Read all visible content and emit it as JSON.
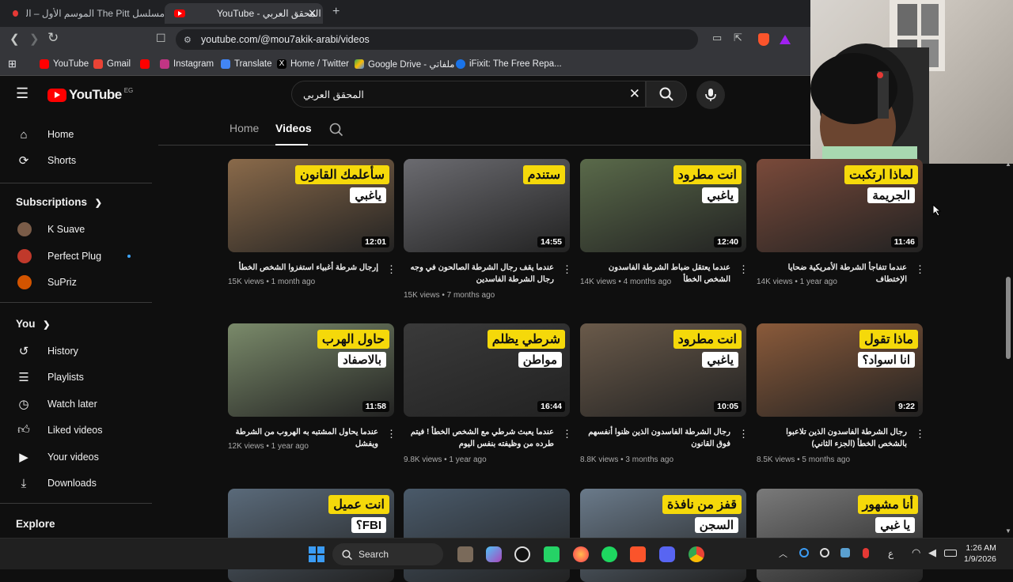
{
  "browser": {
    "tabs": [
      {
        "title": "مسلسل The Pitt الموسم الأول – الحلقة",
        "active": false
      },
      {
        "title": "YouTube - المحقق العربي",
        "active": true
      }
    ],
    "url": "youtube.com/@mou7akik-arabi/videos",
    "bookmarks": [
      {
        "label": "YouTube",
        "color": "#ff0000"
      },
      {
        "label": "Gmail",
        "color": "#ea4335"
      },
      {
        "label": "",
        "color": "#ff0000"
      },
      {
        "label": "Instagram",
        "color": "#c13584"
      },
      {
        "label": "Translate",
        "color": "#4285f4"
      },
      {
        "label": "Home / Twitter",
        "color": "#000000"
      },
      {
        "label": "Google Drive - ملفاتي",
        "color": "#34a853"
      },
      {
        "label": "iFixit: The Free Repa...",
        "color": "#1a73e8"
      }
    ]
  },
  "youtube": {
    "logo_text": "YouTube",
    "country_code": "EG",
    "search_value": "المحقق العربي",
    "sidebar": {
      "main": [
        {
          "label": "Home",
          "icon": "home-icon"
        },
        {
          "label": "Shorts",
          "icon": "shorts-icon"
        }
      ],
      "subscriptions_title": "Subscriptions",
      "subscriptions": [
        {
          "label": "K Suave",
          "color": "#7a5c48"
        },
        {
          "label": "Perfect Plug",
          "color": "#c0392b"
        },
        {
          "label": "SuPriz",
          "color": "#d35400"
        }
      ],
      "you_title": "You",
      "you": [
        {
          "label": "History",
          "icon": "history-icon"
        },
        {
          "label": "Playlists",
          "icon": "playlists-icon"
        },
        {
          "label": "Watch later",
          "icon": "clock-icon"
        },
        {
          "label": "Liked videos",
          "icon": "thumbs-up-icon"
        },
        {
          "label": "Your videos",
          "icon": "video-icon"
        },
        {
          "label": "Downloads",
          "icon": "download-icon"
        }
      ],
      "explore_title": "Explore"
    },
    "channel_tabs": [
      "Home",
      "Videos"
    ],
    "videos": [
      {
        "caption": "سأعلمك القانون",
        "caption2": "ياغبي",
        "duration": "12:01",
        "title": "إرجال شرطة أغبياء استفزوا الشخص الخطأ",
        "views": "15K views",
        "age": "1 month ago",
        "bg": "#8a6a4a"
      },
      {
        "caption": "ستندم",
        "caption2": "",
        "duration": "14:55",
        "title": "عندما يقف رجال الشرطة الصالحون في وجه رجال الشرطة الفاسدين",
        "views": "15K views",
        "age": "7 months ago",
        "bg": "#6b6b70"
      },
      {
        "caption": "انت مطرود",
        "caption2": "ياغبي",
        "duration": "12:40",
        "title": "عندما يعتقل ضباط الشرطة الفاسدون الشخص الخطأ",
        "views": "14K views",
        "age": "4 months ago",
        "bg": "#5a6a4a"
      },
      {
        "caption": "لماذا ارتكبت",
        "caption2": "الجريمة",
        "duration": "11:46",
        "title": "عندما تتفاجأ الشرطة الأمريكية ضحايا الإختطاف",
        "views": "14K views",
        "age": "1 year ago",
        "bg": "#7a4a3a"
      },
      {
        "caption": "حاول الهرب",
        "caption2": "بالاصفاد",
        "duration": "11:58",
        "title": "عندما يحاول المشتبه به الهروب من الشرطة ويفشل",
        "views": "12K views",
        "age": "1 year ago",
        "bg": "#7a8a6a"
      },
      {
        "caption": "شرطي يظلم",
        "caption2": "مواطن",
        "duration": "16:44",
        "title": "عندما يعبث شرطي مع الشخص الخطأ ! فيتم طرده من وظيفته بنفس اليوم",
        "views": "9.8K views",
        "age": "1 year ago",
        "bg": "#3a3a3a"
      },
      {
        "caption": "انت مطرود",
        "caption2": "ياغبي",
        "duration": "10:05",
        "title": "رجال الشرطة الفاسدون الذين ظنوا أنفسهم فوق القانون",
        "views": "8.8K views",
        "age": "3 months ago",
        "bg": "#6a5a4a"
      },
      {
        "caption": "ماذا تقول",
        "caption2": "انا اسواد؟",
        "duration": "9:22",
        "title": "رجال الشرطة الفاسدون الذين تلاعبوا بالشخص الخطأ (الجزء الثاني)",
        "views": "8.5K views",
        "age": "5 months ago",
        "bg": "#8a5a3a"
      },
      {
        "caption": "انت عميل",
        "caption2": "FBI؟",
        "duration": "",
        "title": "",
        "views": "",
        "age": "",
        "bg": "#5a6a7a"
      },
      {
        "caption": "",
        "caption2": "",
        "duration": "",
        "title": "",
        "views": "",
        "age": "",
        "bg": "#4a5a6a"
      },
      {
        "caption": "قفز من نافذة",
        "caption2": "السجن",
        "duration": "",
        "title": "",
        "views": "",
        "age": "",
        "bg": "#6a7a8a"
      },
      {
        "caption": "أنا مشهور",
        "caption2": "يا غبي",
        "duration": "",
        "title": "",
        "views": "",
        "age": "",
        "bg": "#7a7a7a"
      }
    ]
  },
  "taskbar": {
    "search_label": "Search",
    "time": "1:26 AM",
    "date": "1/9/2026",
    "lang": "ع"
  }
}
